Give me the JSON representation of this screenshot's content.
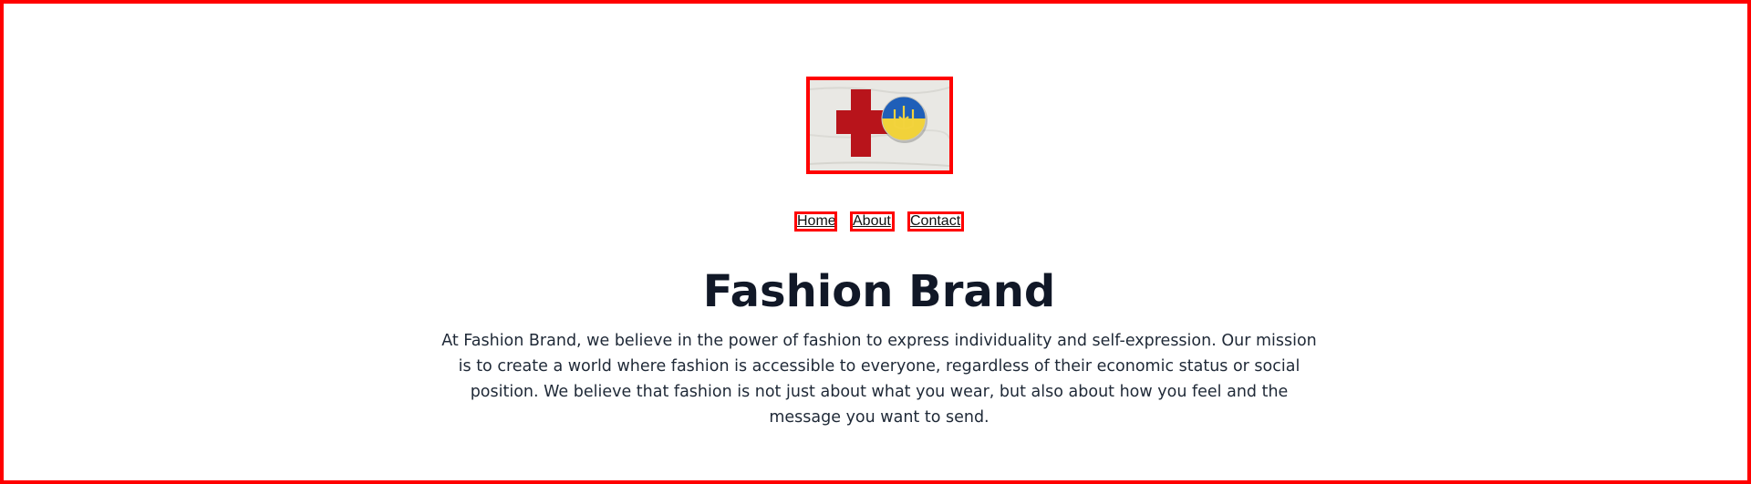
{
  "hero_image": {
    "alt": "Red cross armband with Ukrainian flag pin",
    "colors": {
      "cloth": "#e9e8e4",
      "cross": "#b8141b",
      "flag_blue": "#1f5fb8",
      "flag_yellow": "#f1d23a",
      "trident": "#f3d33d"
    }
  },
  "nav": {
    "items": [
      {
        "label": "Home"
      },
      {
        "label": "About"
      },
      {
        "label": "Contact"
      }
    ]
  },
  "main": {
    "title": "Fashion Brand",
    "mission": "At Fashion Brand, we believe in the power of fashion to express individuality and self-expression. Our mission is to create a world where fashion is accessible to everyone, regardless of their economic status or social position. We believe that fashion is not just about what you wear, but also about how you feel and the message you want to send."
  },
  "colors": {
    "outline": "#ff0000",
    "heading": "#111827",
    "body_text": "#1f2937",
    "background": "#ffffff"
  }
}
